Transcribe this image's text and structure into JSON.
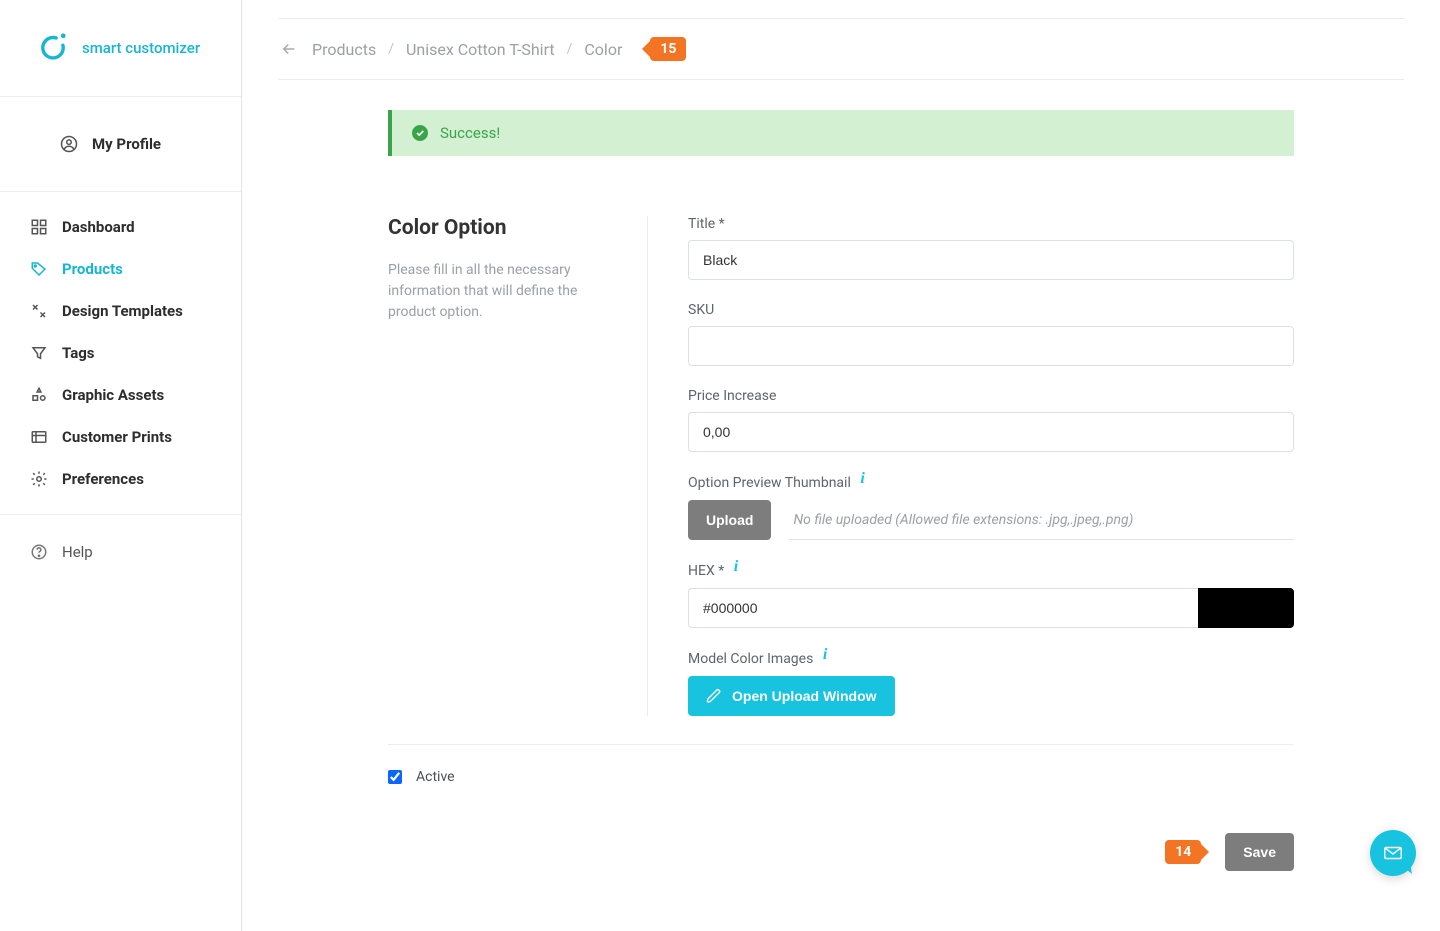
{
  "brand": {
    "name": "smart customizer"
  },
  "sidebar": {
    "profile_label": "My Profile",
    "items": [
      {
        "label": "Dashboard"
      },
      {
        "label": "Products",
        "active": true
      },
      {
        "label": "Design Templates"
      },
      {
        "label": "Tags"
      },
      {
        "label": "Graphic Assets"
      },
      {
        "label": "Customer Prints"
      },
      {
        "label": "Preferences"
      }
    ],
    "help_label": "Help"
  },
  "breadcrumb": {
    "items": [
      "Products",
      "Unisex Cotton T-Shirt",
      "Color"
    ],
    "sep": "/",
    "tour_number": "15"
  },
  "alert": {
    "message": "Success!"
  },
  "color_option": {
    "heading": "Color Option",
    "description": "Please fill in all the necessary information that will define the product option.",
    "fields": {
      "title": {
        "label": "Title *",
        "value": "Black"
      },
      "sku": {
        "label": "SKU",
        "value": ""
      },
      "price_increase": {
        "label": "Price Increase",
        "value": "0,00"
      },
      "thumbnail": {
        "label": "Option Preview Thumbnail",
        "upload_label": "Upload",
        "placeholder": "No file uploaded (Allowed file extensions: .jpg,.jpeg,.png)"
      },
      "hex": {
        "label": "HEX *",
        "value": "#000000",
        "swatch": "#000000"
      },
      "model_images": {
        "label": "Model Color Images",
        "open_window_label": "Open Upload Window"
      }
    },
    "active": {
      "label": "Active",
      "checked": true
    }
  },
  "footer": {
    "tour_number": "14",
    "save_label": "Save"
  }
}
